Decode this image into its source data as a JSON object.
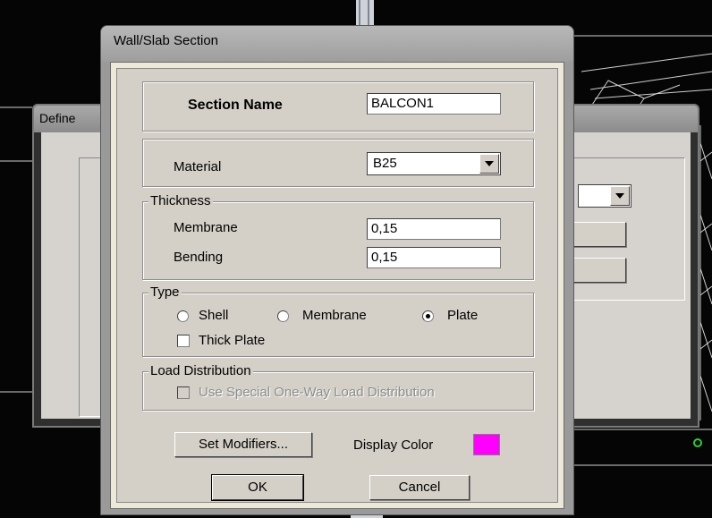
{
  "background_window": {
    "title": "Define"
  },
  "dialog": {
    "title": "Wall/Slab Section",
    "section_name": {
      "label": "Section Name",
      "value": "BALCON1"
    },
    "material": {
      "label": "Material",
      "selected": "B25"
    },
    "thickness": {
      "legend": "Thickness",
      "membrane": {
        "label": "Membrane",
        "value": "0,15"
      },
      "bending": {
        "label": "Bending",
        "value": "0,15"
      }
    },
    "type": {
      "legend": "Type",
      "options": [
        {
          "label": "Shell",
          "selected": false
        },
        {
          "label": "Membrane",
          "selected": false
        },
        {
          "label": "Plate",
          "selected": true
        }
      ],
      "thick_plate": {
        "label": "Thick Plate",
        "checked": false
      }
    },
    "load_distribution": {
      "legend": "Load Distribution",
      "checkbox": {
        "label": "Use Special One-Way Load Distribution",
        "checked": false,
        "enabled": false
      }
    },
    "set_modifiers_label": "Set Modifiers...",
    "display_color": {
      "label": "Display Color",
      "color": "#ff00ff"
    },
    "ok_label": "OK",
    "cancel_label": "Cancel"
  }
}
